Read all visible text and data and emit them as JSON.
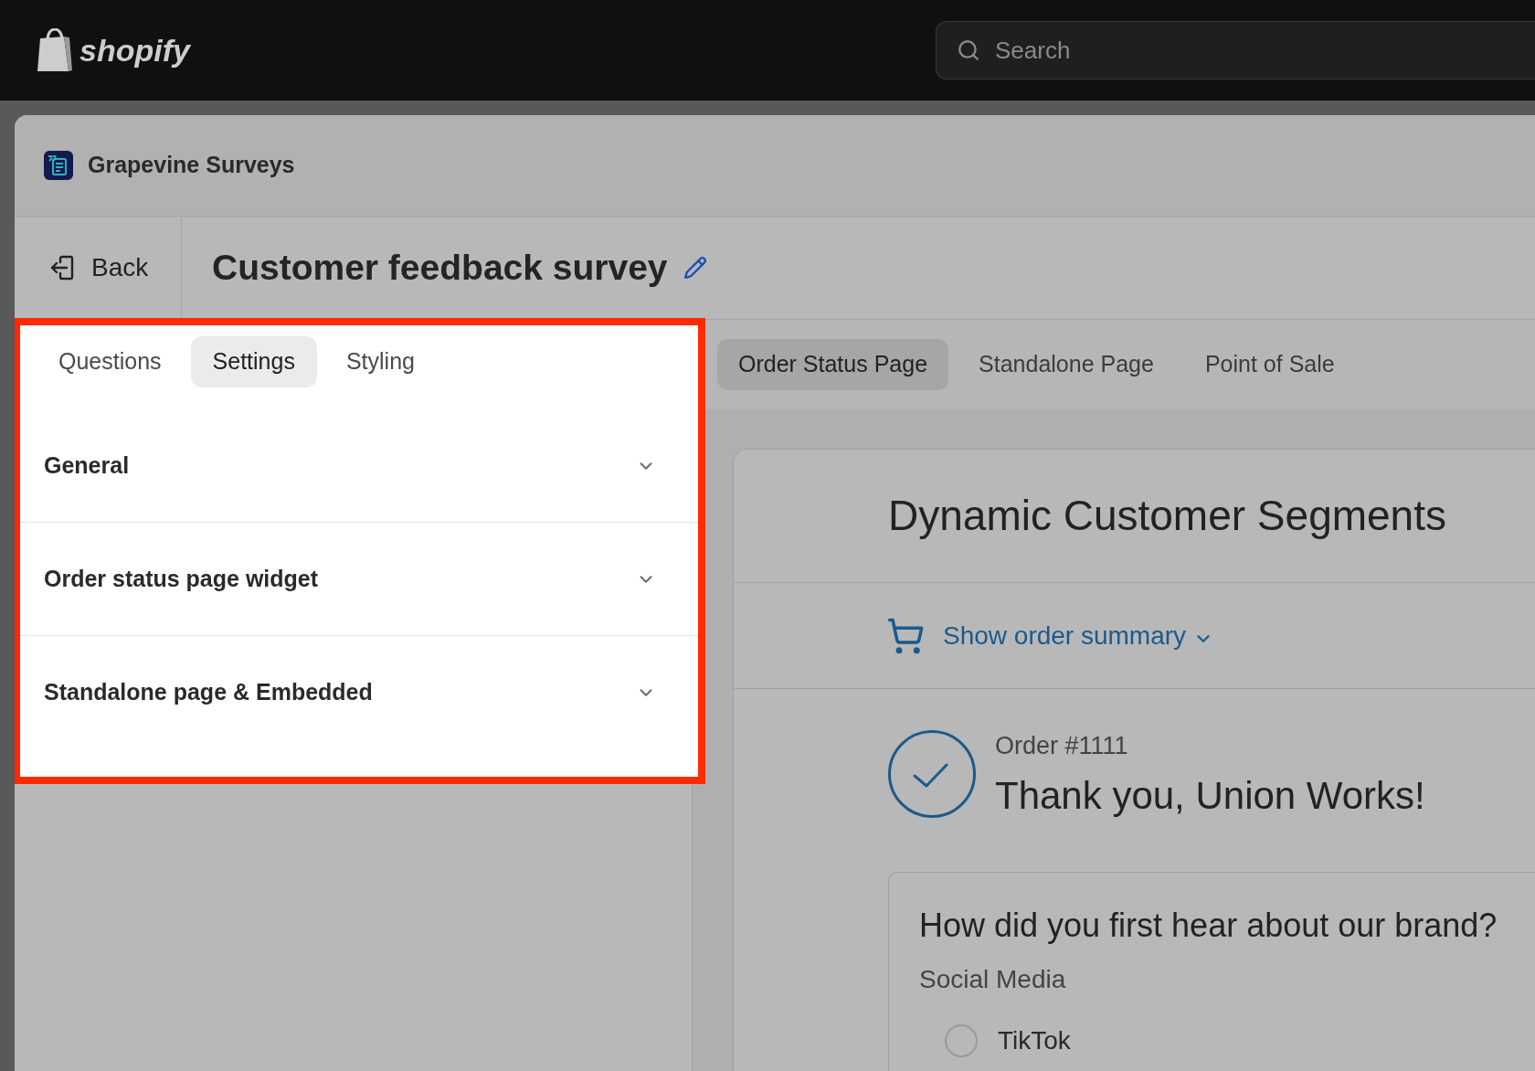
{
  "top_bar": {
    "logo": "shopify",
    "search": {
      "placeholder": "Search"
    }
  },
  "app_header": {
    "title": "Grapevine Surveys"
  },
  "page_header": {
    "back_button": "Back",
    "title": "Customer feedback survey"
  },
  "editor_tabs": [
    {
      "label": "Questions",
      "selected": false
    },
    {
      "label": "Settings",
      "selected": true
    },
    {
      "label": "Styling",
      "selected": false
    }
  ],
  "settings_sections": [
    {
      "title": "General",
      "expanded": false
    },
    {
      "title": "Order status page widget",
      "expanded": false
    },
    {
      "title": "Standalone page & Embedded",
      "expanded": false
    }
  ],
  "preview_tabs": [
    {
      "label": "Order Status Page",
      "selected": true
    },
    {
      "label": "Standalone Page",
      "selected": false
    },
    {
      "label": "Point of Sale",
      "selected": false
    }
  ],
  "preview": {
    "shop_name": "Dynamic Customer Segments",
    "order_summary_toggle": "Show order summary",
    "order_number": "Order #1111",
    "greeting": "Thank you, Union Works!",
    "survey": {
      "question": "How did you first hear about our brand?",
      "category": "Social Media",
      "options": [
        {
          "label": "TikTok",
          "selected": false
        }
      ]
    }
  }
}
